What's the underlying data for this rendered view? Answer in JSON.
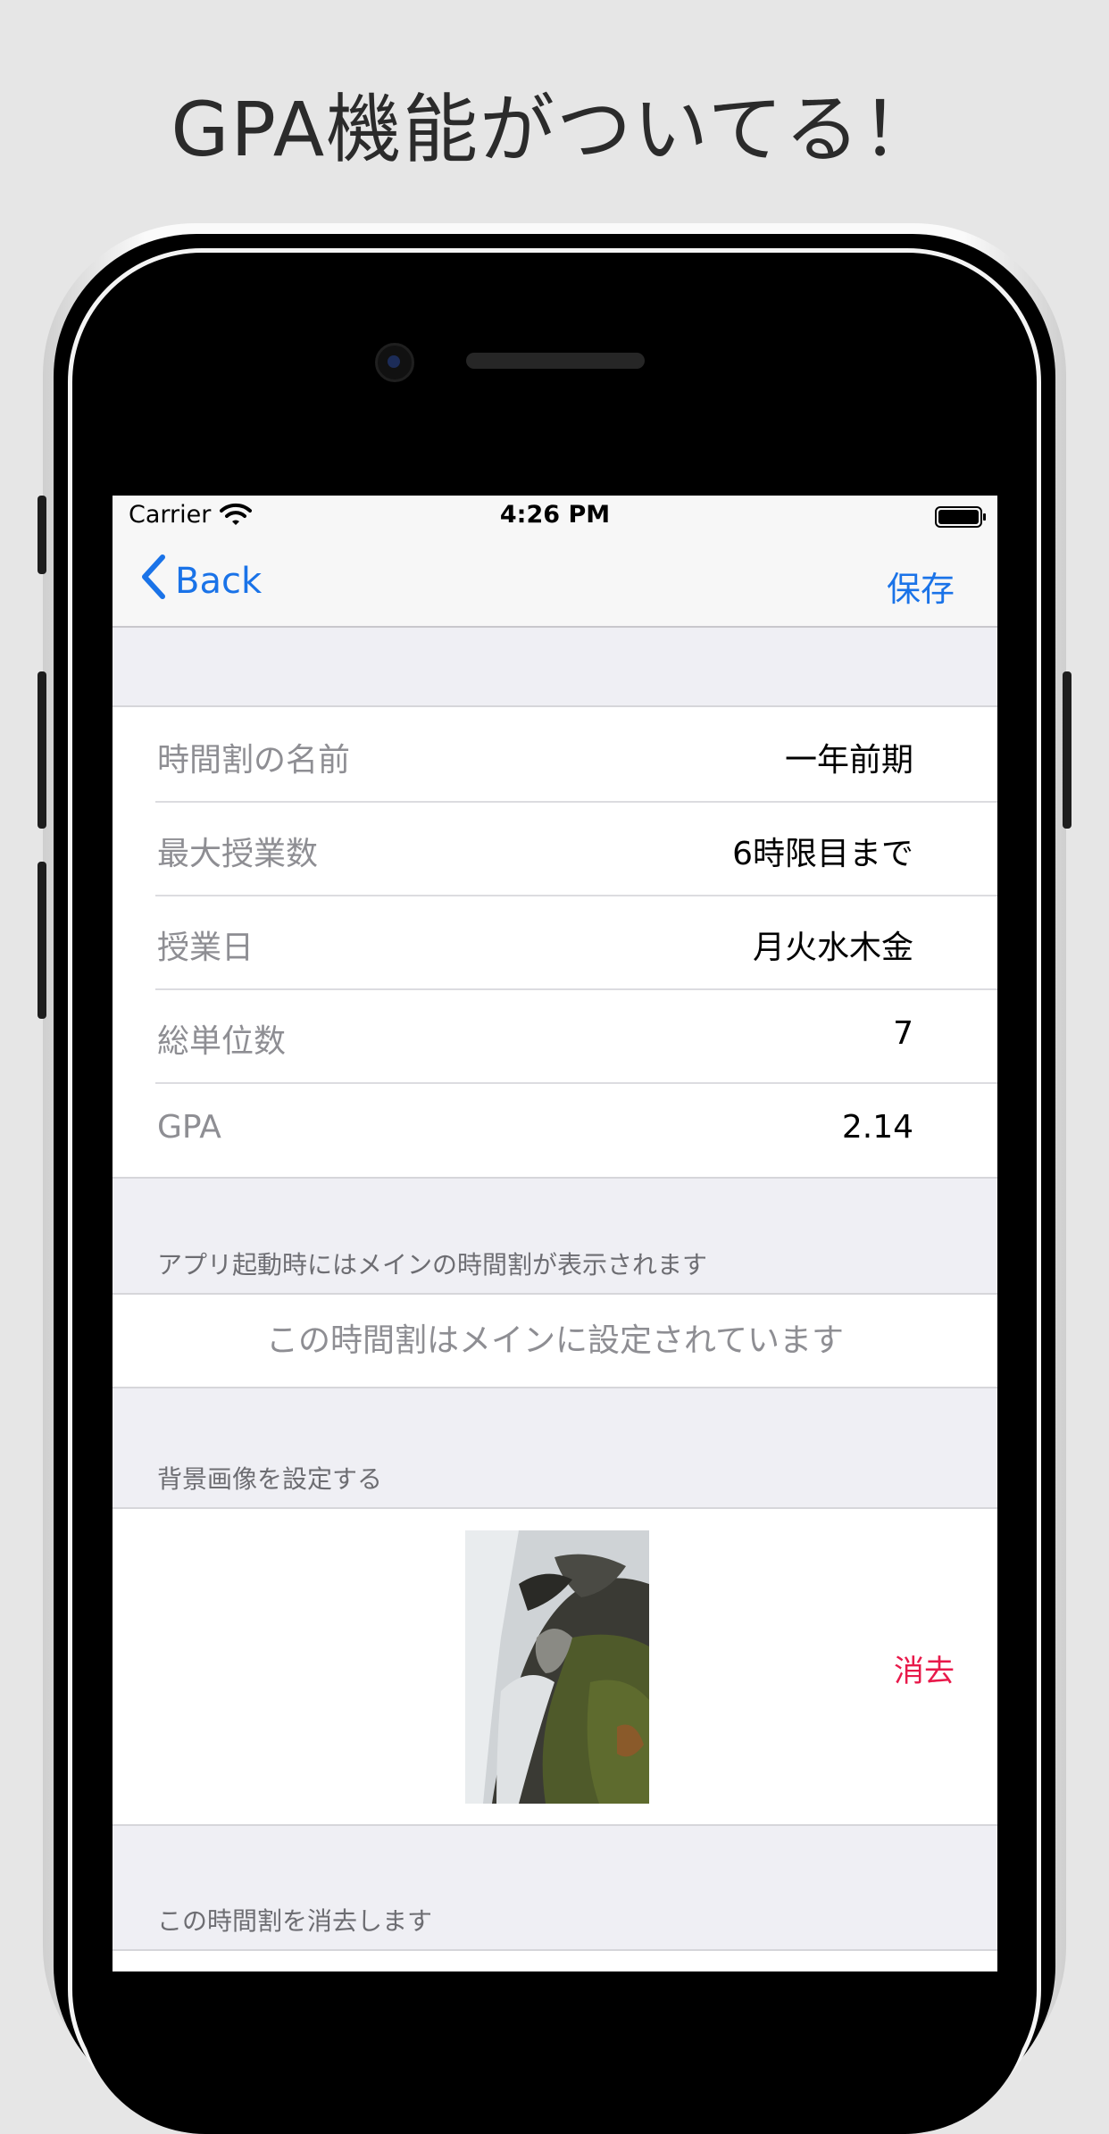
{
  "headline": "GPA機能がついてる！",
  "status_bar": {
    "carrier": "Carrier",
    "time": "4:26 PM"
  },
  "nav": {
    "back_label": "Back",
    "save_label": "保存"
  },
  "settings": {
    "rows": [
      {
        "label": "時間割の名前",
        "value": "一年前期"
      },
      {
        "label": "最大授業数",
        "value": "6時限目まで"
      },
      {
        "label": "授業日",
        "value": "月火水木金"
      },
      {
        "label": "総単位数",
        "value": "7"
      },
      {
        "label": "GPA",
        "value": "2.14"
      }
    ]
  },
  "main_section": {
    "header": "アプリ起動時にはメインの時間割が表示されます",
    "cell_text": "この時間割はメインに設定されています"
  },
  "background_section": {
    "header": "背景画像を設定する",
    "delete_label": "消去"
  },
  "delete_section": {
    "header": "この時間割を消去します"
  },
  "colors": {
    "accent": "#1a73e8",
    "destructive": "#e8194a",
    "grouped_background": "#efeff4"
  }
}
